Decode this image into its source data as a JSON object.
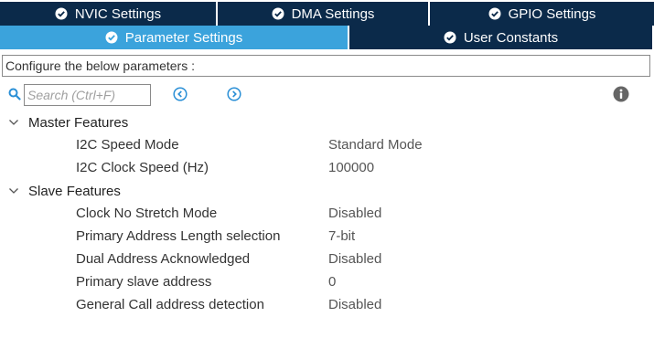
{
  "tabs_row1": [
    {
      "label": "NVIC Settings"
    },
    {
      "label": "DMA Settings"
    },
    {
      "label": "GPIO Settings"
    }
  ],
  "tabs_row2": [
    {
      "label": "Parameter Settings",
      "active": true
    },
    {
      "label": "User Constants",
      "active": false
    }
  ],
  "description": "Configure the below parameters :",
  "search": {
    "placeholder": "Search (Ctrl+F)"
  },
  "icons": {
    "search": "search-icon",
    "prev": "arrow-left-circle-icon",
    "next": "arrow-right-circle-icon",
    "info": "info-icon",
    "check": "check-circle-icon",
    "chevron": "chevron-down-icon"
  },
  "colors": {
    "tab_dark": "#0b2a4a",
    "tab_active": "#3ba3dc",
    "nav_icon": "#2a8fd6",
    "search_icon": "#2a8fd6"
  },
  "groups": [
    {
      "label": "Master Features",
      "params": [
        {
          "name": "I2C Speed Mode",
          "value": "Standard Mode"
        },
        {
          "name": "I2C Clock Speed (Hz)",
          "value": "100000"
        }
      ]
    },
    {
      "label": "Slave Features",
      "params": [
        {
          "name": "Clock No Stretch Mode",
          "value": "Disabled"
        },
        {
          "name": "Primary Address Length selection",
          "value": "7-bit"
        },
        {
          "name": "Dual Address Acknowledged",
          "value": "Disabled"
        },
        {
          "name": "Primary slave address",
          "value": "0"
        },
        {
          "name": "General Call address detection",
          "value": "Disabled"
        }
      ]
    }
  ]
}
